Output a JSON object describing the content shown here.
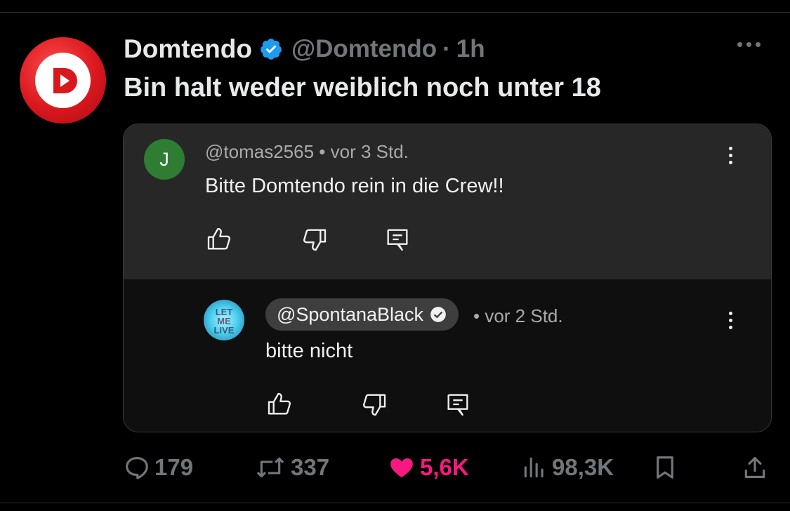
{
  "tweet": {
    "author_name": "Domtendo",
    "handle": "@Domtendo",
    "separator": "·",
    "time": "1h",
    "text": "Bin halt weder weiblich noch unter 18"
  },
  "embedded_comments": {
    "comment": {
      "avatar_letter": "J",
      "handle": "@tomas2565",
      "meta": "• vor 3 Std.",
      "text": "Bitte Domtendo rein in die Crew!!"
    },
    "reply": {
      "avatar_text": "LET ME LIVE",
      "handle": "@SpontanaBlack",
      "meta": "• vor 2 Std.",
      "text": "bitte nicht"
    }
  },
  "stats": {
    "replies": "179",
    "retweets": "337",
    "likes": "5,6K",
    "views": "98,3K"
  },
  "colors": {
    "background": "#000000",
    "like_active": "#f91880",
    "verified": "#1d9bf0",
    "muted": "#71767b"
  },
  "icons": [
    "logo-d-icon",
    "verified-icon",
    "more-horizontal-icon",
    "more-vertical-icon",
    "thumbs-up-icon",
    "thumbs-down-icon",
    "reply-comment-icon",
    "reply-icon",
    "retweet-icon",
    "heart-icon",
    "views-icon",
    "bookmark-icon",
    "share-icon"
  ]
}
